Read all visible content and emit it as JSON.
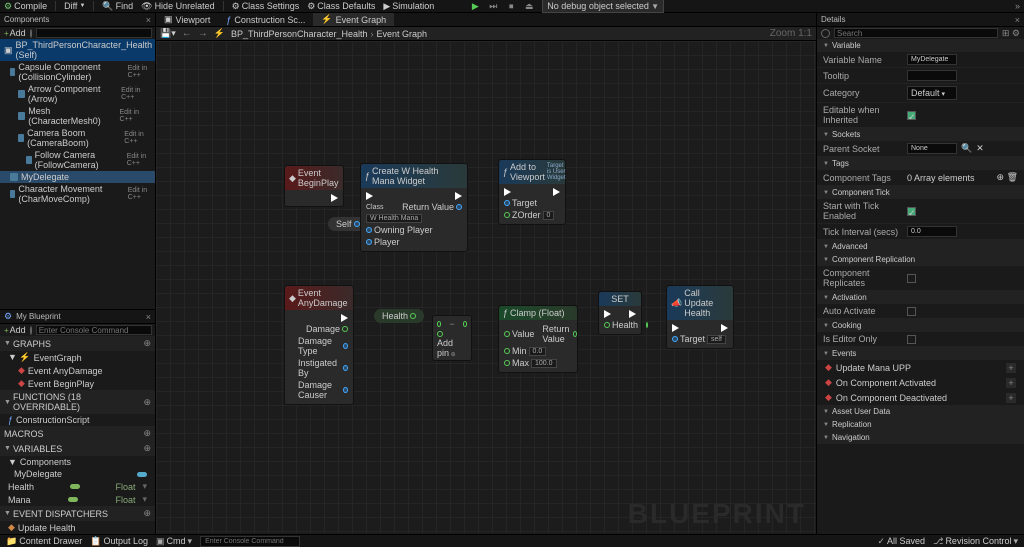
{
  "toolbar": {
    "compile": "Compile",
    "diff": "Diff",
    "find": "Find",
    "hide": "Hide Unrelated",
    "classSettings": "Class Settings",
    "classDefaults": "Class Defaults",
    "simulation": "Simulation",
    "debugSel": "No debug object selected"
  },
  "components": {
    "title": "Components",
    "add": "Add",
    "root": "BP_ThirdPersonCharacter_Health (Self)",
    "items": [
      {
        "label": "Capsule Component (CollisionCylinder)",
        "edit": "Edit in C++"
      },
      {
        "label": "Arrow Component (Arrow)",
        "edit": "Edit in C++"
      },
      {
        "label": "Mesh (CharacterMesh0)",
        "edit": "Edit in C++"
      },
      {
        "label": "Camera Boom (CameraBoom)",
        "edit": "Edit in C++"
      },
      {
        "label": "Follow Camera (FollowCamera)",
        "edit": "Edit in C++"
      },
      {
        "label": "MyDelegate",
        "edit": ""
      },
      {
        "label": "Character Movement (CharMoveComp)",
        "edit": "Edit in C++"
      }
    ]
  },
  "myBlueprint": {
    "title": "My Blueprint",
    "add": "Add",
    "graphs": {
      "hdr": "GRAPHS",
      "root": "EventGraph",
      "items": [
        "Event AnyDamage",
        "Event BeginPlay"
      ]
    },
    "functions": {
      "hdr": "FUNCTIONS (18 OVERRIDABLE)",
      "items": [
        "ConstructionScript"
      ]
    },
    "macros": {
      "hdr": "MACROS"
    },
    "variables": {
      "hdr": "VARIABLES",
      "cat": "Components",
      "items": [
        {
          "name": "MyDelegate",
          "type": ""
        },
        {
          "name": "Health",
          "type": "Float"
        },
        {
          "name": "Mana",
          "type": "Float"
        }
      ]
    },
    "dispatchers": {
      "hdr": "EVENT DISPATCHERS",
      "items": [
        "Update Health"
      ]
    }
  },
  "centerTabs": [
    "Viewport",
    "Construction Sc...",
    "Event Graph"
  ],
  "breadcrumb": {
    "root": "BP_ThirdPersonCharacter_Health",
    "leaf": "Event Graph"
  },
  "zoom": "Zoom 1:1",
  "nodes": {
    "beginPlay": "Event BeginPlay",
    "createWidget": {
      "title": "Create W Health Mana Widget",
      "class": "Class",
      "classVal": "W Health Mana",
      "retVal": "Return Value",
      "owning": "Owning Player",
      "player": "Player"
    },
    "addViewport": {
      "title": "Add to Viewport",
      "sub": "Target is User Widget",
      "target": "Target",
      "zorder": "ZOrder",
      "zval": "0"
    },
    "self": "Self",
    "anyDamage": {
      "title": "Event AnyDamage",
      "damage": "Damage",
      "dtype": "Damage Type",
      "inst": "Instigated By",
      "causer": "Damage Causer"
    },
    "health": "Health",
    "subtract": "Add pin",
    "clamp": {
      "title": "Clamp (Float)",
      "value": "Value",
      "retVal": "Return Value",
      "min": "Min",
      "minV": "0.0",
      "max": "Max",
      "maxV": "100.0"
    },
    "set": {
      "title": "SET",
      "health": "Health"
    },
    "callUpdate": {
      "title": "Call Update Health",
      "target": "Target",
      "tval": "self"
    }
  },
  "watermark": "BLUEPRINT",
  "details": {
    "title": "Details",
    "sections": {
      "variable": "Variable",
      "sockets": "Sockets",
      "tags": "Tags",
      "compTick": "Component Tick",
      "advanced": "Advanced",
      "compRep": "Component Replication",
      "activation": "Activation",
      "cooking": "Cooking",
      "events": "Events",
      "assetUser": "Asset User Data",
      "replication": "Replication",
      "navigation": "Navigation"
    },
    "fields": {
      "varName": {
        "label": "Variable Name",
        "val": "MyDelegate"
      },
      "tooltip": {
        "label": "Tooltip",
        "val": ""
      },
      "category": {
        "label": "Category",
        "val": "Default"
      },
      "editable": {
        "label": "Editable when Inherited"
      },
      "parentSocket": {
        "label": "Parent Socket",
        "val": "None"
      },
      "compTags": {
        "label": "Component Tags",
        "val": "0 Array elements"
      },
      "startTick": {
        "label": "Start with Tick Enabled"
      },
      "tickInterval": {
        "label": "Tick Interval (secs)",
        "val": "0.0"
      },
      "compRep": {
        "label": "Component Replicates"
      },
      "autoAct": {
        "label": "Auto Activate"
      },
      "editorOnly": {
        "label": "Is Editor Only"
      }
    },
    "eventItems": [
      "Update Mana UPP",
      "On Component Activated",
      "On Component Deactivated"
    ]
  },
  "statusbar": {
    "drawer": "Content Drawer",
    "output": "Output Log",
    "cmd": "Cmd",
    "cmdPh": "Enter Console Command",
    "saved": "All Saved",
    "revision": "Revision Control"
  }
}
